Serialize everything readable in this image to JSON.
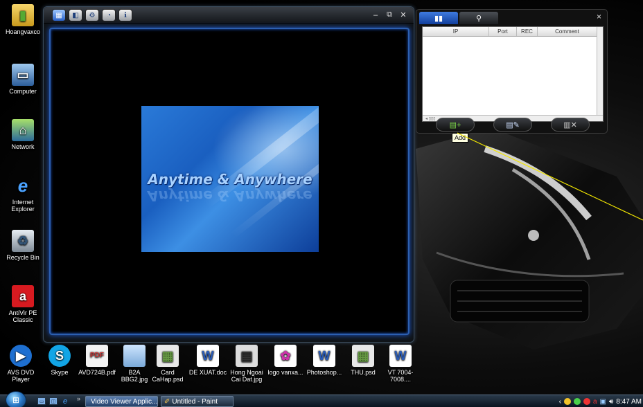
{
  "desktop": {
    "left_icons": [
      {
        "label": "Hoangvaxco",
        "icon": "folder-icon"
      },
      {
        "label": "Computer",
        "icon": "computer-icon"
      },
      {
        "label": "Network",
        "icon": "network-icon"
      },
      {
        "label": "Internet Explorer",
        "icon": "internet-explorer-icon"
      },
      {
        "label": "Recycle Bin",
        "icon": "recycle-bin-icon"
      },
      {
        "label": "AntiVir PE Classic",
        "icon": "antivir-icon"
      }
    ],
    "bottom_icons": [
      {
        "label": "AVS DVD Player",
        "icon": "avs-dvd-player-icon"
      },
      {
        "label": "Skype",
        "icon": "skype-icon"
      },
      {
        "label": "AVD724B.pdf",
        "icon": "pdf-icon"
      },
      {
        "label": "B2A BBG2.jpg",
        "icon": "image-icon"
      },
      {
        "label": "Card CaHap.psd",
        "icon": "psd-icon"
      },
      {
        "label": "DE XUAT.doc",
        "icon": "word-icon"
      },
      {
        "label": "Hong Ngoai Cai Dat.jpg",
        "icon": "image-icon"
      },
      {
        "label": "logo vanxa...",
        "icon": "logo-icon"
      },
      {
        "label": "Photoshop...",
        "icon": "word-icon"
      },
      {
        "label": "THU.psd",
        "icon": "psd-icon"
      },
      {
        "label": "VT 7004-7008....",
        "icon": "word-icon"
      }
    ]
  },
  "viewer": {
    "toolbar_icons": [
      "layout-icon",
      "camera-icon",
      "settings-icon",
      "playback-icon",
      "info-icon"
    ],
    "window_controls": {
      "minimize": "–",
      "restore": "⧉",
      "close": "✕"
    },
    "splash_text": "Anytime & Anywhere"
  },
  "camera_list": {
    "tabs": [
      {
        "icon": "list-icon",
        "active": true
      },
      {
        "icon": "search-icon",
        "active": false
      }
    ],
    "close_label": "×",
    "columns": [
      "IP",
      "Port",
      "REC",
      "Comment"
    ],
    "rows": [],
    "actions": [
      {
        "name": "add",
        "tooltip": "Add"
      },
      {
        "name": "edit"
      },
      {
        "name": "delete"
      }
    ]
  },
  "taskbar": {
    "quick_launch": [
      "show-desktop-icon",
      "switch-windows-icon",
      "internet-explorer-icon"
    ],
    "more": "»",
    "tasks": [
      {
        "label": "Video Viewer Applic...",
        "active": true
      },
      {
        "label": "Untitled - Paint",
        "active": false
      }
    ],
    "clock": "8:47 AM"
  }
}
